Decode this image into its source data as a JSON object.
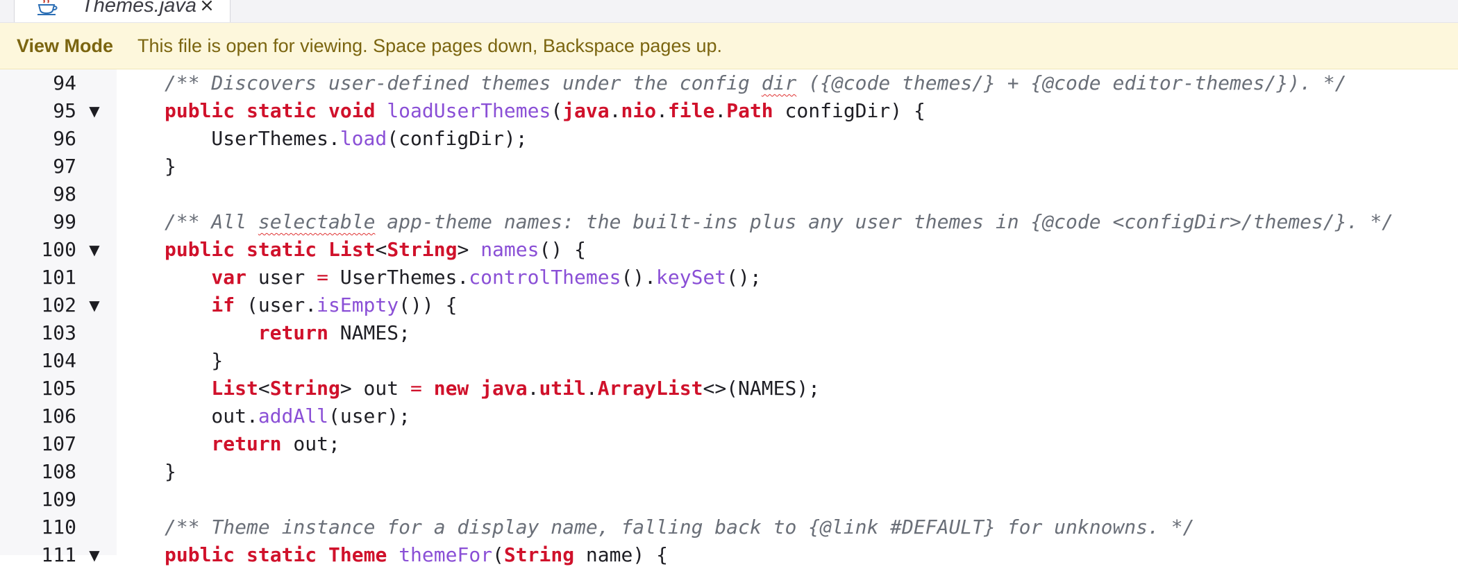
{
  "tab": {
    "title": "Themes.java",
    "close_symbol": "×",
    "icon": "java-cup-icon"
  },
  "banner": {
    "label": "View Mode",
    "text": "This file is open for viewing. Space pages down, Backspace pages up."
  },
  "colors": {
    "keyword": "#d0112b",
    "method": "#8a4fd6",
    "comment": "#6a6f78",
    "banner_bg": "#fdf7dc",
    "banner_fg": "#7b6510",
    "gutter_bg": "#f7f7f9"
  },
  "editor": {
    "fold_symbol": "▼",
    "lines": [
      {
        "n": "94",
        "fold": false,
        "indent": 0,
        "tokens": [
          {
            "t": "/** Discovers user-defined themes under the config ",
            "c": "cm"
          },
          {
            "t": "dir",
            "c": "cm squig"
          },
          {
            "t": " ({@code themes/} + {@code editor-themes/}). */",
            "c": "cm"
          }
        ]
      },
      {
        "n": "95",
        "fold": true,
        "indent": 0,
        "tokens": [
          {
            "t": "public",
            "c": "kw"
          },
          {
            "t": " "
          },
          {
            "t": "static",
            "c": "kw"
          },
          {
            "t": " "
          },
          {
            "t": "void",
            "c": "kw"
          },
          {
            "t": " "
          },
          {
            "t": "loadUserThemes",
            "c": "fn"
          },
          {
            "t": "("
          },
          {
            "t": "java",
            "c": "ty"
          },
          {
            "t": "."
          },
          {
            "t": "nio",
            "c": "ty"
          },
          {
            "t": "."
          },
          {
            "t": "file",
            "c": "ty"
          },
          {
            "t": "."
          },
          {
            "t": "Path",
            "c": "ty"
          },
          {
            "t": " configDir) {"
          }
        ]
      },
      {
        "n": "96",
        "fold": false,
        "indent": 1,
        "tokens": [
          {
            "t": "UserThemes."
          },
          {
            "t": "load",
            "c": "fn"
          },
          {
            "t": "(configDir);"
          }
        ]
      },
      {
        "n": "97",
        "fold": false,
        "indent": 0,
        "tokens": [
          {
            "t": "}"
          }
        ]
      },
      {
        "n": "98",
        "fold": false,
        "indent": 0,
        "tokens": []
      },
      {
        "n": "99",
        "fold": false,
        "indent": 0,
        "tokens": [
          {
            "t": "/** All ",
            "c": "cm"
          },
          {
            "t": "selectable",
            "c": "cm squig"
          },
          {
            "t": " app-theme names: the built-ins plus any user themes in {@code <configDir>/themes/}. */",
            "c": "cm"
          }
        ]
      },
      {
        "n": "100",
        "fold": true,
        "indent": 0,
        "tokens": [
          {
            "t": "public",
            "c": "kw"
          },
          {
            "t": " "
          },
          {
            "t": "static",
            "c": "kw"
          },
          {
            "t": " "
          },
          {
            "t": "List",
            "c": "ty"
          },
          {
            "t": "<"
          },
          {
            "t": "String",
            "c": "ty"
          },
          {
            "t": "> "
          },
          {
            "t": "names",
            "c": "fn"
          },
          {
            "t": "() {"
          }
        ]
      },
      {
        "n": "101",
        "fold": false,
        "indent": 1,
        "tokens": [
          {
            "t": "var",
            "c": "kw"
          },
          {
            "t": " user "
          },
          {
            "t": "=",
            "c": "op"
          },
          {
            "t": " UserThemes."
          },
          {
            "t": "controlThemes",
            "c": "fn"
          },
          {
            "t": "()."
          },
          {
            "t": "keySet",
            "c": "fn"
          },
          {
            "t": "();"
          }
        ]
      },
      {
        "n": "102",
        "fold": true,
        "indent": 1,
        "tokens": [
          {
            "t": "if",
            "c": "kw"
          },
          {
            "t": " (user."
          },
          {
            "t": "isEmpty",
            "c": "fn"
          },
          {
            "t": "()) {"
          }
        ]
      },
      {
        "n": "103",
        "fold": false,
        "indent": 2,
        "tokens": [
          {
            "t": "return",
            "c": "kw"
          },
          {
            "t": " NAMES;"
          }
        ]
      },
      {
        "n": "104",
        "fold": false,
        "indent": 1,
        "tokens": [
          {
            "t": "}"
          }
        ]
      },
      {
        "n": "105",
        "fold": false,
        "indent": 1,
        "tokens": [
          {
            "t": "List",
            "c": "ty"
          },
          {
            "t": "<"
          },
          {
            "t": "String",
            "c": "ty"
          },
          {
            "t": "> out "
          },
          {
            "t": "=",
            "c": "op"
          },
          {
            "t": " "
          },
          {
            "t": "new",
            "c": "kw"
          },
          {
            "t": " "
          },
          {
            "t": "java",
            "c": "ty"
          },
          {
            "t": "."
          },
          {
            "t": "util",
            "c": "ty"
          },
          {
            "t": "."
          },
          {
            "t": "ArrayList",
            "c": "ty"
          },
          {
            "t": "<>(NAMES);"
          }
        ]
      },
      {
        "n": "106",
        "fold": false,
        "indent": 1,
        "tokens": [
          {
            "t": "out."
          },
          {
            "t": "addAll",
            "c": "fn"
          },
          {
            "t": "(user);"
          }
        ]
      },
      {
        "n": "107",
        "fold": false,
        "indent": 1,
        "tokens": [
          {
            "t": "return",
            "c": "kw"
          },
          {
            "t": " out;"
          }
        ]
      },
      {
        "n": "108",
        "fold": false,
        "indent": 0,
        "tokens": [
          {
            "t": "}"
          }
        ]
      },
      {
        "n": "109",
        "fold": false,
        "indent": 0,
        "tokens": []
      },
      {
        "n": "110",
        "fold": false,
        "indent": 0,
        "tokens": [
          {
            "t": "/** Theme instance for a display name, falling back to {@link #DEFAULT} for unknowns. */",
            "c": "cm"
          }
        ]
      },
      {
        "n": "111",
        "fold": true,
        "indent": 0,
        "tokens": [
          {
            "t": "public",
            "c": "kw"
          },
          {
            "t": " "
          },
          {
            "t": "static",
            "c": "kw"
          },
          {
            "t": " "
          },
          {
            "t": "Theme",
            "c": "ty"
          },
          {
            "t": " "
          },
          {
            "t": "themeFor",
            "c": "fn"
          },
          {
            "t": "("
          },
          {
            "t": "String",
            "c": "ty"
          },
          {
            "t": " name) {"
          }
        ]
      }
    ]
  }
}
